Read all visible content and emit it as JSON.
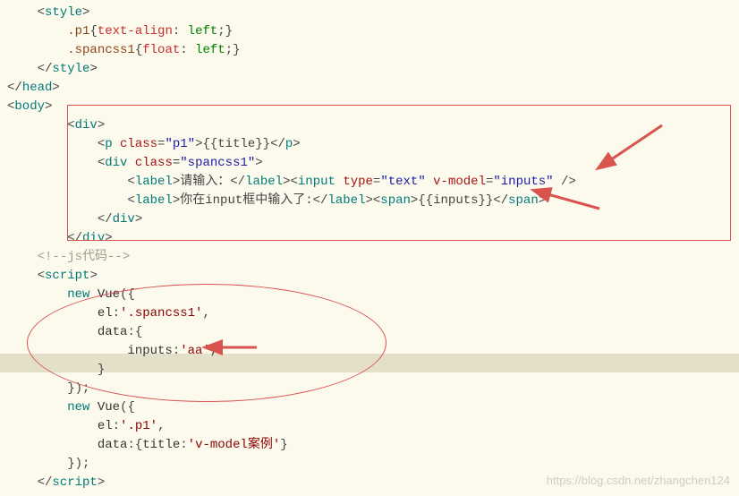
{
  "code": {
    "lines": [
      [
        {
          "cls": "punct",
          "t": "    <"
        },
        {
          "cls": "tag",
          "t": "style"
        },
        {
          "cls": "punct",
          "t": ">"
        }
      ],
      [
        {
          "cls": "punct",
          "t": "        "
        },
        {
          "cls": "css-sel",
          "t": ".p1"
        },
        {
          "cls": "punct",
          "t": "{"
        },
        {
          "cls": "css-prop",
          "t": "text-align"
        },
        {
          "cls": "punct",
          "t": ": "
        },
        {
          "cls": "css-val",
          "t": "left"
        },
        {
          "cls": "punct",
          "t": ";}"
        }
      ],
      [
        {
          "cls": "punct",
          "t": "        "
        },
        {
          "cls": "css-sel",
          "t": ".spancss1"
        },
        {
          "cls": "punct",
          "t": "{"
        },
        {
          "cls": "css-prop",
          "t": "float"
        },
        {
          "cls": "punct",
          "t": ": "
        },
        {
          "cls": "css-val",
          "t": "left"
        },
        {
          "cls": "punct",
          "t": ";}"
        }
      ],
      [
        {
          "cls": "punct",
          "t": "    </"
        },
        {
          "cls": "tag",
          "t": "style"
        },
        {
          "cls": "punct",
          "t": ">"
        }
      ],
      [
        {
          "cls": "punct",
          "t": "</"
        },
        {
          "cls": "tag",
          "t": "head"
        },
        {
          "cls": "punct",
          "t": ">"
        }
      ],
      [
        {
          "cls": "punct",
          "t": "<"
        },
        {
          "cls": "tag",
          "t": "body"
        },
        {
          "cls": "punct",
          "t": ">"
        }
      ],
      [
        {
          "cls": "punct",
          "t": "        <"
        },
        {
          "cls": "tag",
          "t": "div"
        },
        {
          "cls": "punct",
          "t": ">"
        }
      ],
      [
        {
          "cls": "punct",
          "t": "            <"
        },
        {
          "cls": "tag",
          "t": "p"
        },
        {
          "cls": "punct",
          "t": " "
        },
        {
          "cls": "attr-name",
          "t": "class"
        },
        {
          "cls": "punct",
          "t": "="
        },
        {
          "cls": "attr-val",
          "t": "\"p1\""
        },
        {
          "cls": "punct",
          "t": ">{{title}}</"
        },
        {
          "cls": "tag",
          "t": "p"
        },
        {
          "cls": "punct",
          "t": ">"
        }
      ],
      [
        {
          "cls": "punct",
          "t": "            <"
        },
        {
          "cls": "tag",
          "t": "div"
        },
        {
          "cls": "punct",
          "t": " "
        },
        {
          "cls": "attr-name",
          "t": "class"
        },
        {
          "cls": "punct",
          "t": "="
        },
        {
          "cls": "attr-val",
          "t": "\"spancss1\""
        },
        {
          "cls": "punct",
          "t": ">"
        }
      ],
      [
        {
          "cls": "punct",
          "t": "                <"
        },
        {
          "cls": "tag",
          "t": "label"
        },
        {
          "cls": "punct",
          "t": ">请输入：</"
        },
        {
          "cls": "tag",
          "t": "label"
        },
        {
          "cls": "punct",
          "t": "><"
        },
        {
          "cls": "tag",
          "t": "input"
        },
        {
          "cls": "punct",
          "t": " "
        },
        {
          "cls": "attr-name",
          "t": "type"
        },
        {
          "cls": "punct",
          "t": "="
        },
        {
          "cls": "attr-val",
          "t": "\"text\""
        },
        {
          "cls": "punct",
          "t": " "
        },
        {
          "cls": "attr-name",
          "t": "v-model"
        },
        {
          "cls": "punct",
          "t": "="
        },
        {
          "cls": "attr-val",
          "t": "\"inputs\""
        },
        {
          "cls": "punct",
          "t": " />"
        }
      ],
      [
        {
          "cls": "punct",
          "t": "                <"
        },
        {
          "cls": "tag",
          "t": "label"
        },
        {
          "cls": "punct",
          "t": ">你在input框中输入了:</"
        },
        {
          "cls": "tag",
          "t": "label"
        },
        {
          "cls": "punct",
          "t": "><"
        },
        {
          "cls": "tag",
          "t": "span"
        },
        {
          "cls": "punct",
          "t": ">{{inputs}}</"
        },
        {
          "cls": "tag",
          "t": "span"
        },
        {
          "cls": "punct",
          "t": ">"
        }
      ],
      [
        {
          "cls": "punct",
          "t": "            </"
        },
        {
          "cls": "tag",
          "t": "div"
        },
        {
          "cls": "punct",
          "t": ">"
        }
      ],
      [
        {
          "cls": "punct",
          "t": "        </"
        },
        {
          "cls": "tag",
          "t": "div"
        },
        {
          "cls": "punct",
          "t": ">"
        }
      ],
      [
        {
          "cls": "punct",
          "t": "    "
        },
        {
          "cls": "comment",
          "t": "<!--js代码-->"
        }
      ],
      [
        {
          "cls": "punct",
          "t": "    <"
        },
        {
          "cls": "tag",
          "t": "script"
        },
        {
          "cls": "punct",
          "t": ">"
        }
      ],
      [
        {
          "cls": "punct",
          "t": "        "
        },
        {
          "cls": "js-keyword",
          "t": "new"
        },
        {
          "cls": "punct",
          "t": " "
        },
        {
          "cls": "js-ident",
          "t": "Vue"
        },
        {
          "cls": "punct",
          "t": "({"
        }
      ],
      [
        {
          "cls": "punct",
          "t": "            "
        },
        {
          "cls": "js-ident",
          "t": "el"
        },
        {
          "cls": "punct",
          "t": ":"
        },
        {
          "cls": "js-str",
          "t": "'.spancss1'"
        },
        {
          "cls": "punct",
          "t": ","
        }
      ],
      [
        {
          "cls": "punct",
          "t": "            "
        },
        {
          "cls": "js-ident",
          "t": "data"
        },
        {
          "cls": "punct",
          "t": ":{"
        }
      ],
      [
        {
          "cls": "punct",
          "t": "                "
        },
        {
          "cls": "js-ident",
          "t": "inputs"
        },
        {
          "cls": "punct",
          "t": ":"
        },
        {
          "cls": "js-str",
          "t": "'aa'"
        },
        {
          "cls": "punct",
          "t": ","
        }
      ],
      [
        {
          "cls": "punct",
          "t": "            }"
        }
      ],
      [
        {
          "cls": "punct",
          "t": "        });"
        }
      ],
      [
        {
          "cls": "punct",
          "t": "        "
        },
        {
          "cls": "js-keyword",
          "t": "new"
        },
        {
          "cls": "punct",
          "t": " "
        },
        {
          "cls": "js-ident",
          "t": "Vue"
        },
        {
          "cls": "punct",
          "t": "({"
        }
      ],
      [
        {
          "cls": "punct",
          "t": "            "
        },
        {
          "cls": "js-ident",
          "t": "el"
        },
        {
          "cls": "punct",
          "t": ":"
        },
        {
          "cls": "js-str",
          "t": "'.p1'"
        },
        {
          "cls": "punct",
          "t": ","
        }
      ],
      [
        {
          "cls": "punct",
          "t": "            "
        },
        {
          "cls": "js-ident",
          "t": "data"
        },
        {
          "cls": "punct",
          "t": ":{"
        },
        {
          "cls": "js-ident",
          "t": "title"
        },
        {
          "cls": "punct",
          "t": ":"
        },
        {
          "cls": "js-str",
          "t": "'v-model案例'"
        },
        {
          "cls": "punct",
          "t": "}"
        }
      ],
      [
        {
          "cls": "punct",
          "t": "        });"
        }
      ],
      [
        {
          "cls": "punct",
          "t": "    </"
        },
        {
          "cls": "tag",
          "t": "script"
        },
        {
          "cls": "punct",
          "t": ">"
        }
      ]
    ]
  },
  "watermark": "https://blog.csdn.net/zhangchen124"
}
